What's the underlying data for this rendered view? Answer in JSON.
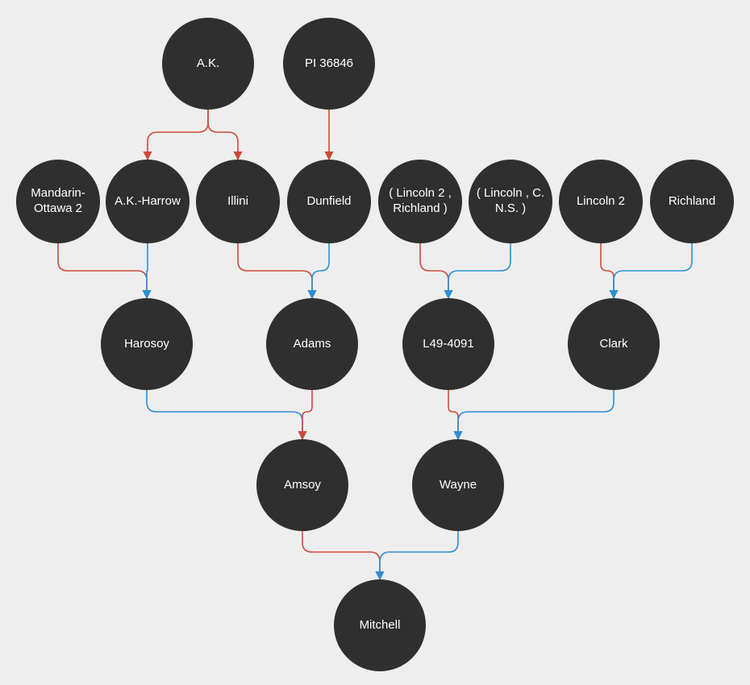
{
  "diagram": {
    "type": "pedigree-tree",
    "colors": {
      "node_fill": "#2f2f2f",
      "node_text": "#ffffff",
      "edge_red": "#cd4b3a",
      "edge_blue": "#2d8fd6",
      "background": "#eeeeee"
    },
    "nodes": {
      "ak": {
        "label": "A.K.",
        "row": 0
      },
      "pi36846": {
        "label": "PI 36846",
        "row": 0
      },
      "mandarin": {
        "label": "Mandarin-Ottawa 2",
        "row": 1
      },
      "akharrow": {
        "label": "A.K.-Harrow",
        "row": 1
      },
      "illini": {
        "label": "Illini",
        "row": 1
      },
      "dunfield": {
        "label": "Dunfield",
        "row": 1
      },
      "linc2rich": {
        "label": "( Lincoln 2 , Richland )",
        "row": 1
      },
      "linccns": {
        "label": "( Lincoln , C. N.S. )",
        "row": 1
      },
      "lincoln2": {
        "label": "Lincoln 2",
        "row": 1
      },
      "richland": {
        "label": "Richland",
        "row": 1
      },
      "harosoy": {
        "label": "Harosoy",
        "row": 2
      },
      "adams": {
        "label": "Adams",
        "row": 2
      },
      "l494091": {
        "label": "L49-4091",
        "row": 2
      },
      "clark": {
        "label": "Clark",
        "row": 2
      },
      "amsoy": {
        "label": "Amsoy",
        "row": 3
      },
      "wayne": {
        "label": "Wayne",
        "row": 3
      },
      "mitchell": {
        "label": "Mitchell",
        "row": 4
      }
    },
    "edges": [
      {
        "from": "ak",
        "to": "akharrow",
        "color": "red"
      },
      {
        "from": "ak",
        "to": "illini",
        "color": "red"
      },
      {
        "from": "pi36846",
        "to": "dunfield",
        "color": "red"
      },
      {
        "from": "mandarin",
        "to": "harosoy",
        "color": "red"
      },
      {
        "from": "akharrow",
        "to": "harosoy",
        "color": "blue"
      },
      {
        "from": "illini",
        "to": "adams",
        "color": "red"
      },
      {
        "from": "dunfield",
        "to": "adams",
        "color": "blue"
      },
      {
        "from": "linc2rich",
        "to": "l494091",
        "color": "red"
      },
      {
        "from": "linccns",
        "to": "l494091",
        "color": "blue"
      },
      {
        "from": "lincoln2",
        "to": "clark",
        "color": "red"
      },
      {
        "from": "richland",
        "to": "clark",
        "color": "blue"
      },
      {
        "from": "harosoy",
        "to": "amsoy",
        "color": "blue"
      },
      {
        "from": "adams",
        "to": "amsoy",
        "color": "red"
      },
      {
        "from": "l494091",
        "to": "wayne",
        "color": "red"
      },
      {
        "from": "clark",
        "to": "wayne",
        "color": "blue"
      },
      {
        "from": "amsoy",
        "to": "mitchell",
        "color": "red"
      },
      {
        "from": "wayne",
        "to": "mitchell",
        "color": "blue"
      }
    ]
  }
}
